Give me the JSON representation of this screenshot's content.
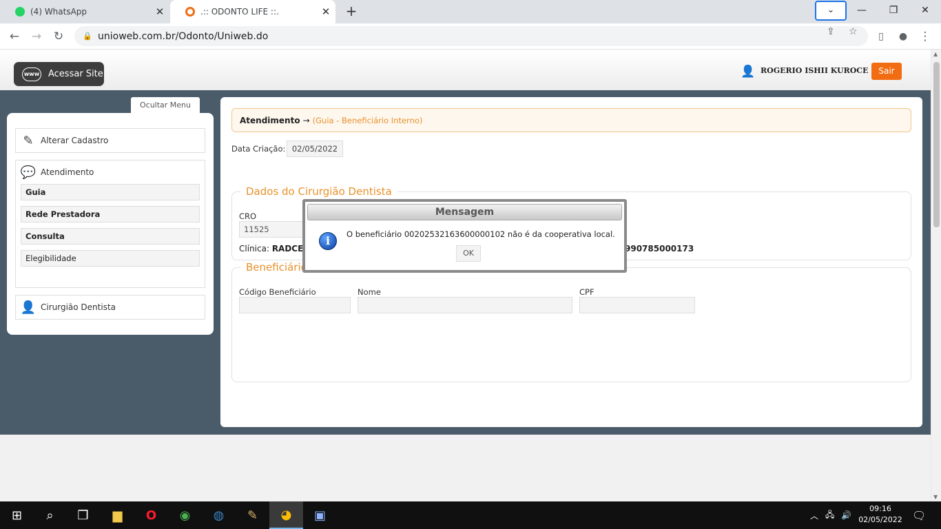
{
  "browser": {
    "tabs": [
      {
        "title": "(4) WhatsApp",
        "active": false,
        "favicon_color": "#25d366"
      },
      {
        "title": ".:: ODONTO LIFE ::.",
        "active": true,
        "favicon_color": "#f26c12"
      }
    ],
    "url": "unioweb.com.br/Odonto/Uniweb.do"
  },
  "header": {
    "site_button": "Acessar Site",
    "www_badge": "www",
    "user_name": "ROGERIO ISHII KUROCE",
    "logout": "Sair"
  },
  "sidebar": {
    "toggle": "Ocultar Menu",
    "items": [
      {
        "label": "Alterar Cadastro"
      },
      {
        "label": "Atendimento",
        "children": [
          "Guia",
          "Rede Prestadora",
          "Consulta",
          "Elegibilidade"
        ]
      },
      {
        "label": "Cirurgião Dentista"
      }
    ]
  },
  "main": {
    "breadcrumb": {
      "main": "Atendimento",
      "arrow": "→",
      "sub": "(Guia - Beneficiário Interno)"
    },
    "date": {
      "label": "Data Criação:",
      "value": "02/05/2022"
    },
    "dentist": {
      "legend": "Dados do Cirurgião Dentista",
      "cro_label": "CRO",
      "cro_value": "11525",
      "clinic_label": "Clínica:",
      "clinic_value": "RADCEN",
      "cnpj_partial": "990785000173"
    },
    "beneficiary": {
      "legend": "Beneficiário",
      "code_label": "Código Beneficiário",
      "name_label": "Nome",
      "cpf_label": "CPF"
    }
  },
  "dialog": {
    "title": "Mensagem",
    "message": "O beneficiário 00202532163600000102 não é da cooperativa local.",
    "ok": "OK"
  },
  "taskbar": {
    "time": "09:16",
    "date": "02/05/2022"
  },
  "colors": {
    "accent": "#e8912b",
    "logout": "#f26c12",
    "band": "#4a5b6a"
  }
}
